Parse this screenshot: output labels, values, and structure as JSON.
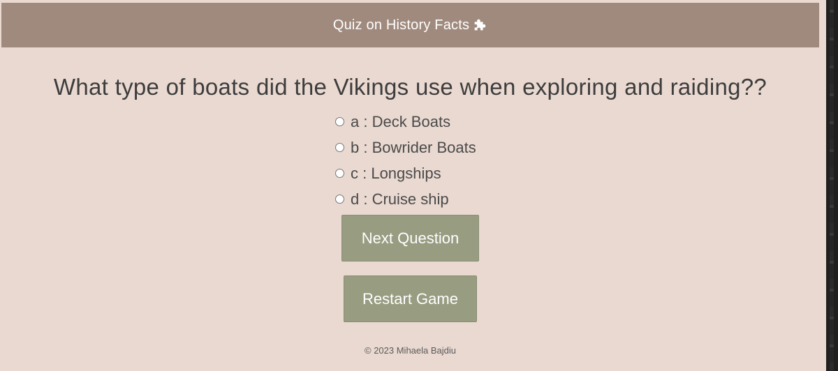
{
  "header": {
    "title": "Quiz on History Facts",
    "icon": "puzzle-piece-icon",
    "background": "#a08a7e"
  },
  "quiz": {
    "question": "What type of boats did the Vikings use when exploring and raiding??",
    "options": [
      {
        "label": "a : Deck Boats"
      },
      {
        "label": "b : Bowrider Boats"
      },
      {
        "label": "c : Longships"
      },
      {
        "label": "d : Cruise ship"
      }
    ]
  },
  "buttons": {
    "next_label": "Next Question",
    "restart_label": "Restart Game",
    "color": "#989c81"
  },
  "footer": {
    "text": "© 2023 Mihaela Bajdiu"
  },
  "page": {
    "background": "#ead9d1"
  }
}
